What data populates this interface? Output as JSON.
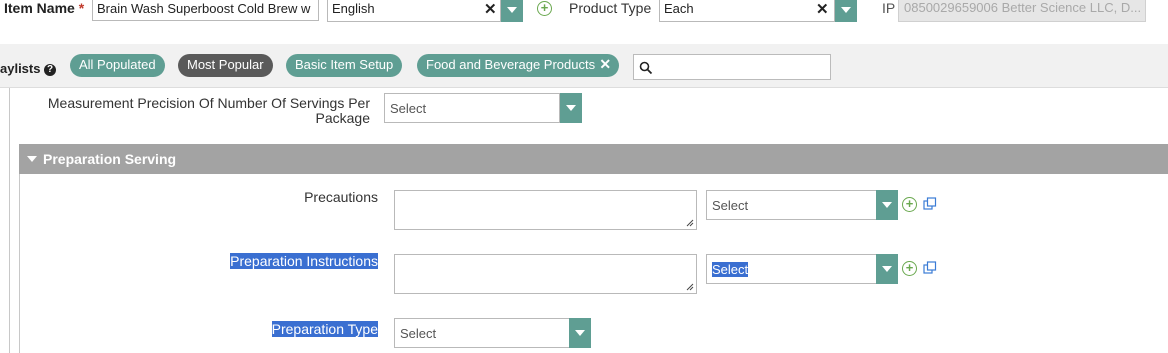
{
  "header": {
    "item_name_label": "Item Name",
    "required_mark": "*",
    "item_name_value": "Brain Wash Superboost Cold Brew w",
    "language_value": "English",
    "product_type_label": "Product Type",
    "product_type_value": "Each",
    "ip_label": "IP",
    "ip_value": "0850029659006 Better Science LLC, D..."
  },
  "filter_bar": {
    "playlists_label": "aylists",
    "help_icon": "?",
    "chips": [
      "All Populated",
      "Most Popular",
      "Basic Item Setup",
      "Food and Beverage Products"
    ]
  },
  "fields": {
    "measurement_precision_label_line1": "Measurement Precision Of Number Of Servings Per",
    "measurement_precision_label_line2": "Package",
    "measurement_precision_value": "Select",
    "section_title": "Preparation Serving",
    "precautions_label": "Precautions",
    "precautions_select": "Select",
    "preparation_instructions_label": "Preparation Instructions",
    "preparation_instructions_select": "Select",
    "preparation_type_label": "Preparation Type",
    "preparation_type_select": "Select"
  },
  "colors": {
    "accent_teal": "#5f9e93",
    "chip_dark": "#5a5a5a",
    "section_header": "#a3a3a3",
    "selection_highlight": "#3a6fd1",
    "add_green": "#6aa84f"
  }
}
